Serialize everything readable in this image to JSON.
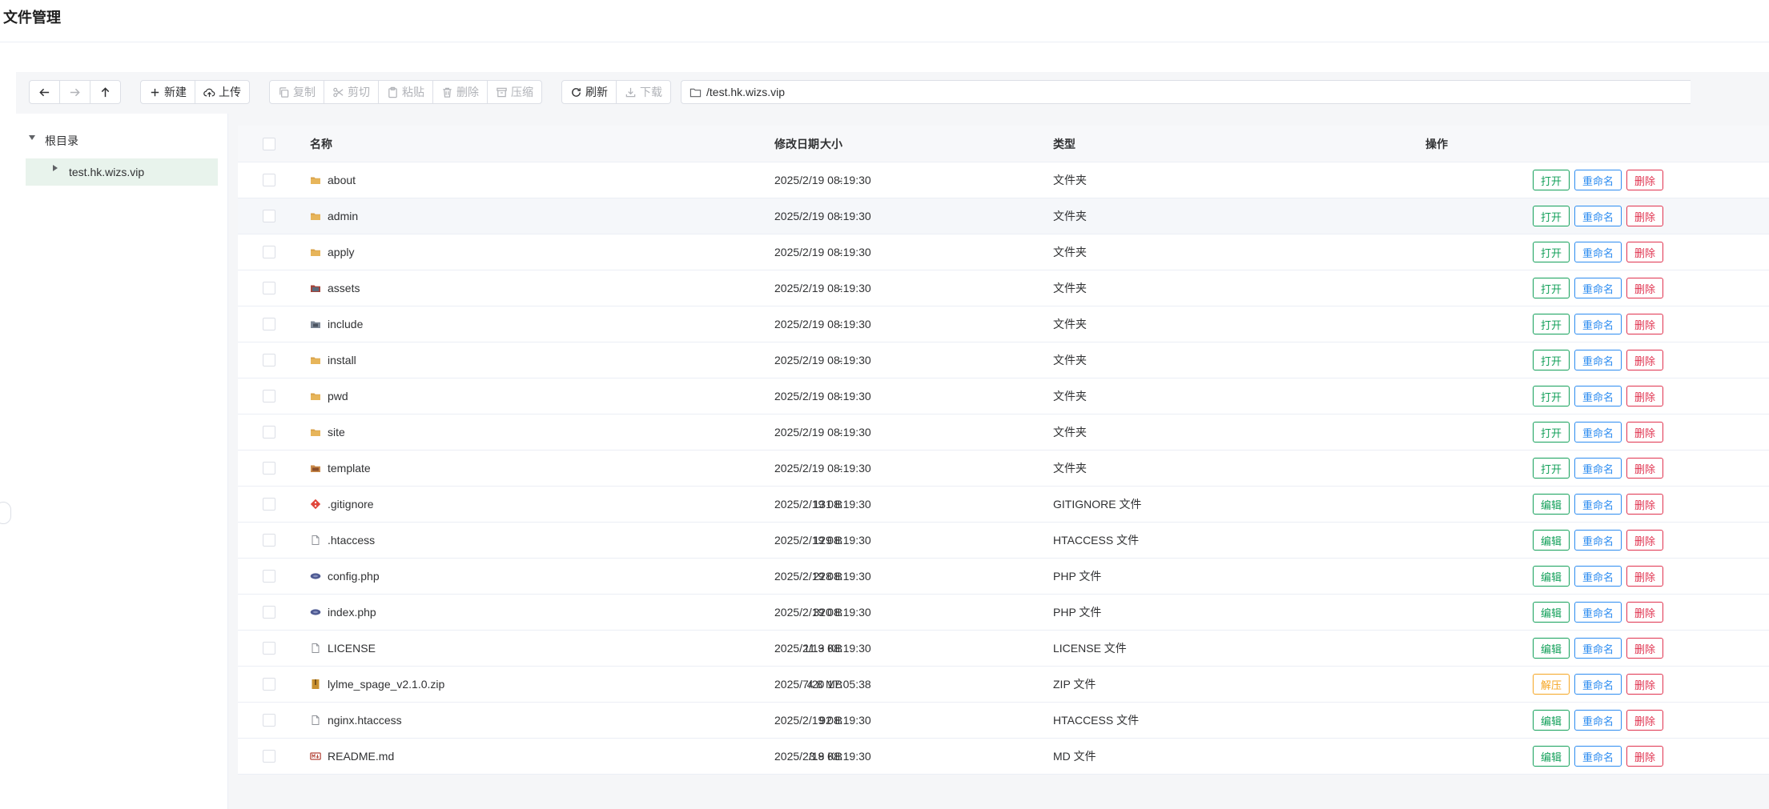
{
  "page": {
    "title": "文件管理"
  },
  "toolbar": {
    "new_label": "新建",
    "upload_label": "上传",
    "copy_label": "复制",
    "cut_label": "剪切",
    "paste_label": "粘贴",
    "delete_label": "删除",
    "compress_label": "压缩",
    "refresh_label": "刷新",
    "download_label": "下载",
    "path": "/test.hk.wizs.vip"
  },
  "tree": {
    "root_label": "根目录",
    "child_label": "test.hk.wizs.vip"
  },
  "table": {
    "headers": {
      "name": "名称",
      "date": "修改日期",
      "type": "类型",
      "size": "大小",
      "ops": "操作"
    },
    "rows": [
      {
        "name": "about",
        "date": "2025/2/19 08:19:30",
        "type": "文件夹",
        "size": "-",
        "icon": "folder-icon",
        "op1": "打开",
        "op2": "重命名",
        "op3": "删除"
      },
      {
        "name": "admin",
        "date": "2025/2/19 08:19:30",
        "type": "文件夹",
        "size": "-",
        "icon": "folder-icon",
        "op1": "打开",
        "op2": "重命名",
        "op3": "删除"
      },
      {
        "name": "apply",
        "date": "2025/2/19 08:19:30",
        "type": "文件夹",
        "size": "-",
        "icon": "folder-icon",
        "op1": "打开",
        "op2": "重命名",
        "op3": "删除"
      },
      {
        "name": "assets",
        "date": "2025/2/19 08:19:30",
        "type": "文件夹",
        "size": "-",
        "icon": "folder-assets-icon",
        "op1": "打开",
        "op2": "重命名",
        "op3": "删除"
      },
      {
        "name": "include",
        "date": "2025/2/19 08:19:30",
        "type": "文件夹",
        "size": "-",
        "icon": "folder-include-icon",
        "op1": "打开",
        "op2": "重命名",
        "op3": "删除"
      },
      {
        "name": "install",
        "date": "2025/2/19 08:19:30",
        "type": "文件夹",
        "size": "-",
        "icon": "folder-icon",
        "op1": "打开",
        "op2": "重命名",
        "op3": "删除"
      },
      {
        "name": "pwd",
        "date": "2025/2/19 08:19:30",
        "type": "文件夹",
        "size": "-",
        "icon": "folder-icon",
        "op1": "打开",
        "op2": "重命名",
        "op3": "删除"
      },
      {
        "name": "site",
        "date": "2025/2/19 08:19:30",
        "type": "文件夹",
        "size": "-",
        "icon": "folder-icon",
        "op1": "打开",
        "op2": "重命名",
        "op3": "删除"
      },
      {
        "name": "template",
        "date": "2025/2/19 08:19:30",
        "type": "文件夹",
        "size": "-",
        "icon": "folder-template-icon",
        "op1": "打开",
        "op2": "重命名",
        "op3": "删除"
      },
      {
        "name": ".gitignore",
        "date": "2025/2/19 08:19:30",
        "type": "GITIGNORE 文件",
        "size": "131 B",
        "icon": "git-icon",
        "op1": "编辑",
        "op2": "重命名",
        "op3": "删除"
      },
      {
        "name": ".htaccess",
        "date": "2025/2/19 08:19:30",
        "type": "HTACCESS 文件",
        "size": "129 B",
        "icon": "file-icon",
        "op1": "编辑",
        "op2": "重命名",
        "op3": "删除"
      },
      {
        "name": "config.php",
        "date": "2025/2/19 08:19:30",
        "type": "PHP 文件",
        "size": "228 B",
        "icon": "php-icon",
        "op1": "编辑",
        "op2": "重命名",
        "op3": "删除"
      },
      {
        "name": "index.php",
        "date": "2025/2/19 08:19:30",
        "type": "PHP 文件",
        "size": "320 B",
        "icon": "php-icon",
        "op1": "编辑",
        "op2": "重命名",
        "op3": "删除"
      },
      {
        "name": "LICENSE",
        "date": "2025/2/19 08:19:30",
        "type": "LICENSE 文件",
        "size": "11.3 KB",
        "icon": "file-icon",
        "op1": "编辑",
        "op2": "重命名",
        "op3": "删除"
      },
      {
        "name": "lylme_spage_v2.1.0.zip",
        "date": "2025/7/20 17:05:38",
        "type": "ZIP 文件",
        "size": "4.8 MB",
        "icon": "zip-icon",
        "op1": "解压",
        "op2": "重命名",
        "op3": "删除"
      },
      {
        "name": "nginx.htaccess",
        "date": "2025/2/19 08:19:30",
        "type": "HTACCESS 文件",
        "size": "92 B",
        "icon": "file-icon",
        "op1": "编辑",
        "op2": "重命名",
        "op3": "删除"
      },
      {
        "name": "README.md",
        "date": "2025/2/19 08:19:30",
        "type": "MD 文件",
        "size": "3.8 KB",
        "icon": "markdown-icon",
        "op1": "编辑",
        "op2": "重命名",
        "op3": "删除"
      }
    ]
  },
  "colors": {
    "accent_green": "#13a05a",
    "accent_blue": "#2d8cf0",
    "accent_red": "#e0334f",
    "accent_orange": "#f5a623"
  }
}
